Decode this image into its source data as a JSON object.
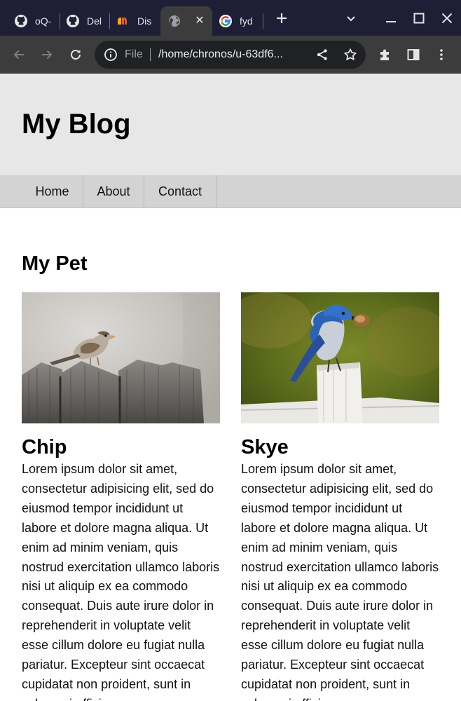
{
  "browser": {
    "tabs": [
      {
        "label": "oQ-",
        "icon": "github-icon"
      },
      {
        "label": "Del",
        "icon": "github-icon"
      },
      {
        "label": "Dis",
        "icon": "tab-site-icon"
      },
      {
        "label": "",
        "icon": "globe-icon"
      },
      {
        "label": "fyd",
        "icon": "google-icon"
      }
    ],
    "omnibox": {
      "scheme_label": "File",
      "url": "/home/chronos/u-63df6..."
    }
  },
  "page": {
    "site_title": "My Blog",
    "nav": [
      "Home",
      "About",
      "Contact"
    ],
    "section_title": "My Pet",
    "pets": [
      {
        "name": "Chip",
        "description": "Lorem ipsum dolor sit amet, consectetur adipisicing elit, sed do eiusmod tempor incididunt ut labore et dolore magna aliqua. Ut enim ad minim veniam, quis nostrud exercitation ullamco laboris nisi ut aliquip ex ea commodo consequat. Duis aute irure dolor in reprehenderit in voluptate velit esse cillum dolore eu fugiat nulla pariatur. Excepteur sint occaecat cupidatat non proident, sunt in culpa qui officia"
      },
      {
        "name": "Skye",
        "description": "Lorem ipsum dolor sit amet, consectetur adipisicing elit, sed do eiusmod tempor incididunt ut labore et dolore magna aliqua. Ut enim ad minim veniam, quis nostrud exercitation ullamco laboris nisi ut aliquip ex ea commodo consequat. Duis aute irure dolor in reprehenderit in voluptate velit esse cillum dolore eu fugiat nulla pariatur. Excepteur sint occaecat cupidatat non proident, sunt in culpa qui officia"
      }
    ]
  },
  "colors": {
    "tabbar_bg": "#1e1f36",
    "toolbar_bg": "#3c3c3c",
    "header_bg": "#e7e7e7",
    "nav_bg": "#d3d3d3"
  }
}
